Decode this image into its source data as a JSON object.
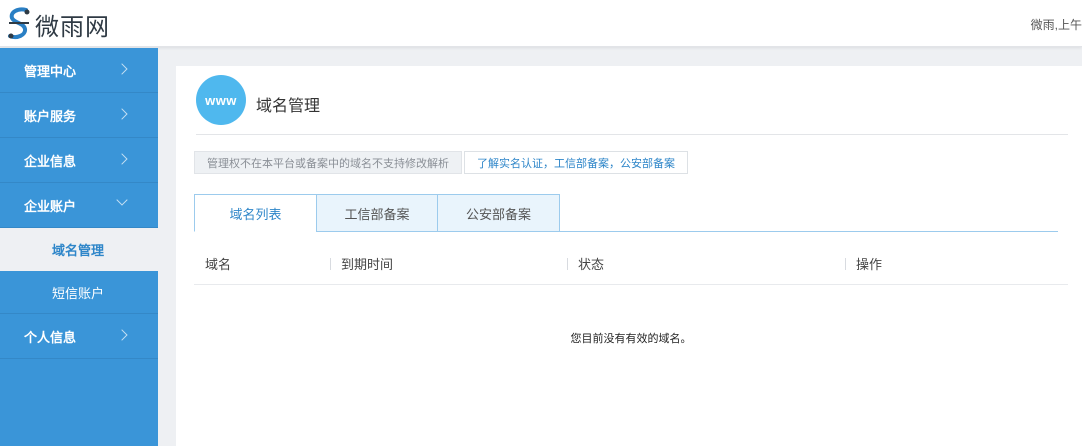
{
  "header": {
    "logo_text": "微雨网",
    "greeting": "微雨,上午"
  },
  "sidebar": {
    "items": [
      {
        "label": "管理中心"
      },
      {
        "label": "账户服务"
      },
      {
        "label": "企业信息"
      },
      {
        "label": "企业账户",
        "expanded": true,
        "children": [
          {
            "label": "域名管理",
            "active": true
          },
          {
            "label": "短信账户"
          }
        ]
      },
      {
        "label": "个人信息"
      }
    ]
  },
  "page": {
    "badge": "www",
    "title": "域名管理",
    "notice": "管理权不在本平台或备案中的域名不支持修改解析",
    "notice_link": "了解实名认证，工信部备案，公安部备案"
  },
  "tabs": [
    {
      "label": "域名列表",
      "active": true
    },
    {
      "label": "工信部备案"
    },
    {
      "label": "公安部备案"
    }
  ],
  "table": {
    "columns": [
      "域名",
      "到期时间",
      "状态",
      "操作"
    ],
    "rows": [],
    "empty_message": "您目前没有有效的域名。"
  },
  "colors": {
    "sidebar_bg": "#3a95d8",
    "accent": "#2e86c9",
    "badge": "#4fb8ee"
  }
}
